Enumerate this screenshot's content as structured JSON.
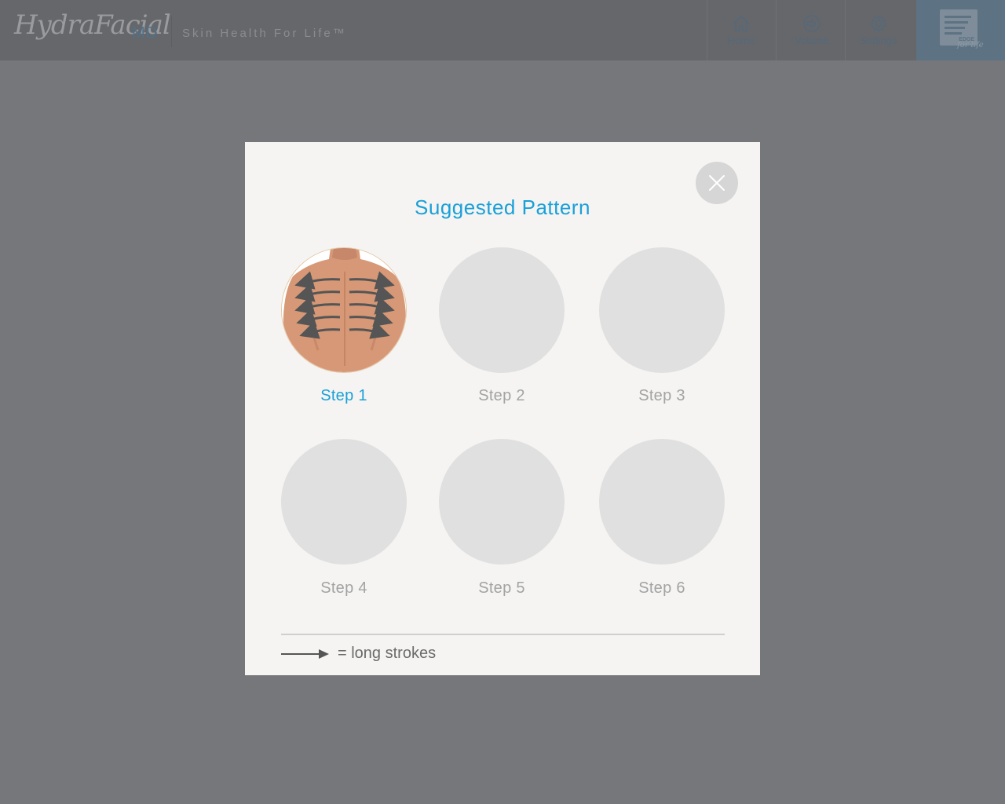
{
  "header": {
    "logo_script": "HydraFacial",
    "logo_suffix": "MD",
    "tagline": "Skin Health For Life™",
    "nav": [
      {
        "label": "Home",
        "icon": "home-icon"
      },
      {
        "label": "Volume",
        "icon": "volume-icon"
      },
      {
        "label": "Settings",
        "icon": "gear-icon"
      }
    ],
    "edge_logo": {
      "text": "EDGE",
      "script": "for life"
    }
  },
  "modal": {
    "title": "Suggested Pattern",
    "steps": [
      {
        "label": "Step 1",
        "active": true
      },
      {
        "label": "Step 2",
        "active": false
      },
      {
        "label": "Step 3",
        "active": false
      },
      {
        "label": "Step 4",
        "active": false
      },
      {
        "label": "Step 5",
        "active": false
      },
      {
        "label": "Step 6",
        "active": false
      }
    ],
    "legend_text": "= long strokes"
  },
  "colors": {
    "accent": "#1aa0d8",
    "overlay": "#76777b",
    "modal_bg": "#f5f4f2",
    "inactive_step": "#e0e0e0"
  }
}
